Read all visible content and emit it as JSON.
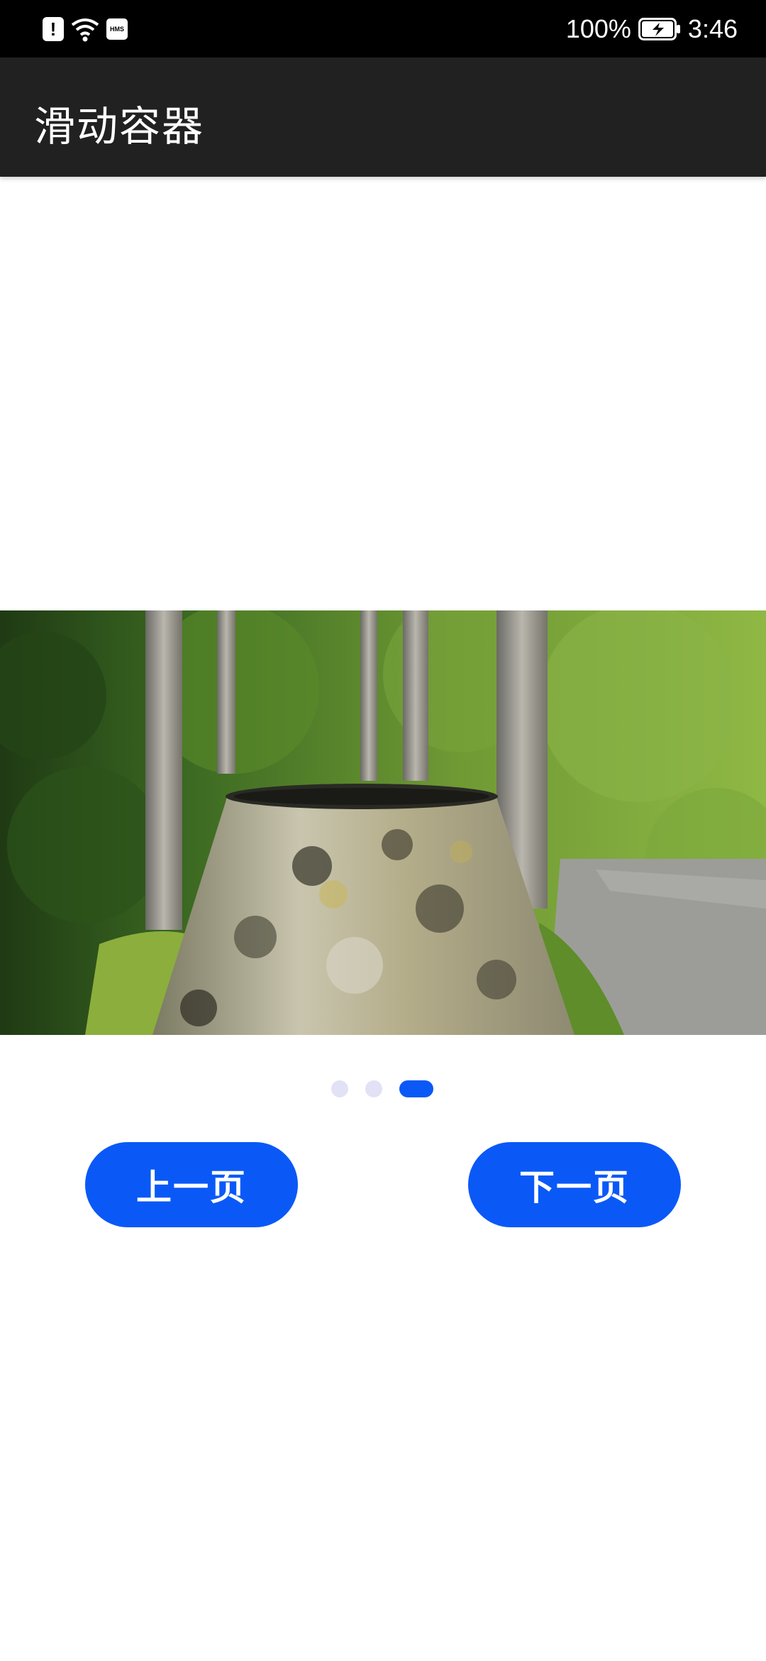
{
  "status_bar": {
    "battery_percent": "100%",
    "time": "3:46",
    "hms_label": "HMS"
  },
  "app_bar": {
    "title": "滑动容器"
  },
  "swiper": {
    "page_count": 3,
    "current_page": 3
  },
  "buttons": {
    "prev_label": "上一页",
    "next_label": "下一页"
  },
  "colors": {
    "accent": "#0a59f7",
    "indicator_inactive": "#e1e2f6",
    "app_bar_bg": "#212121",
    "status_bar_bg": "#000000"
  }
}
